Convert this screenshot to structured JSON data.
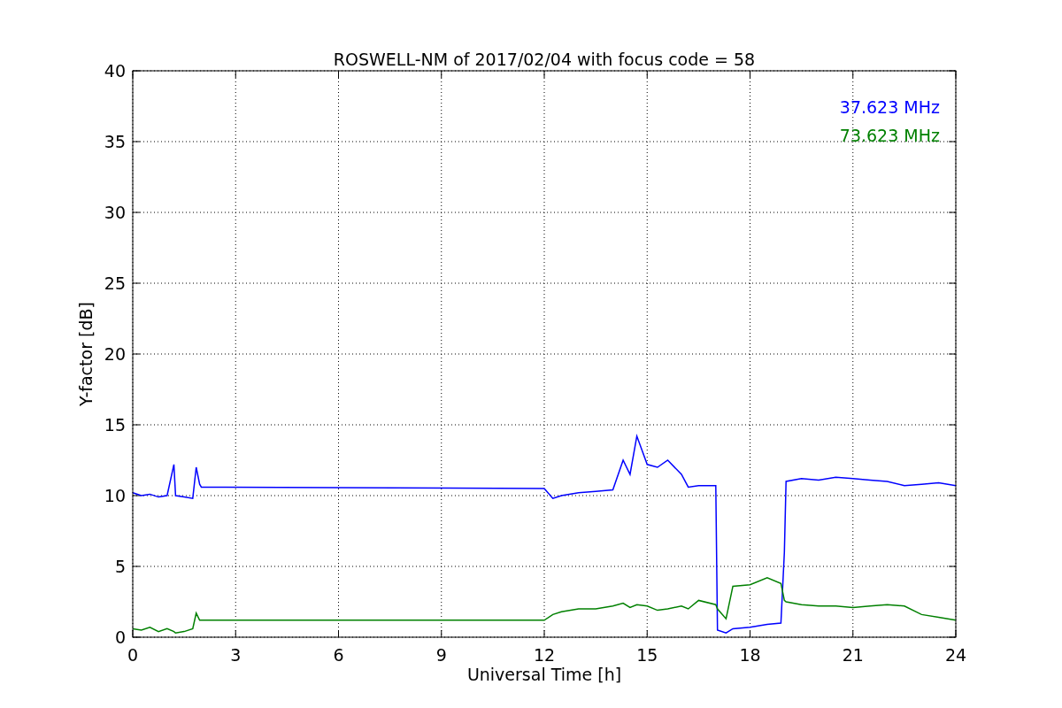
{
  "figure": {
    "chart_data": {
      "type": "line",
      "title": "ROSWELL-NM of 2017/02/04 with focus code = 58",
      "xlabel": "Universal Time [h]",
      "ylabel": "Y-factor [dB]",
      "x": [
        0,
        0.25,
        0.5,
        0.75,
        1,
        1.2,
        1.25,
        1.5,
        1.75,
        1.85,
        1.95,
        2,
        12,
        12.25,
        12.5,
        13,
        13.5,
        14,
        14.3,
        14.5,
        14.7,
        15,
        15.3,
        15.6,
        16,
        16.2,
        16.5,
        17,
        17.05,
        17.3,
        17.5,
        18,
        18.5,
        18.9,
        19,
        19.05,
        19.5,
        20,
        20.5,
        21,
        21.5,
        22,
        22.5,
        23,
        23.5,
        24
      ],
      "series": [
        {
          "name": "37.623 MHz",
          "color": "#0000ff",
          "values": [
            10.2,
            10.0,
            10.1,
            9.9,
            10.0,
            12.2,
            10.0,
            9.9,
            9.8,
            12.0,
            10.8,
            10.6,
            10.5,
            9.8,
            10.0,
            10.2,
            10.3,
            10.4,
            12.5,
            11.5,
            14.2,
            12.2,
            12.0,
            12.5,
            11.5,
            10.6,
            10.7,
            10.7,
            0.5,
            0.3,
            0.6,
            0.7,
            0.9,
            1.0,
            6.0,
            11.0,
            11.2,
            11.1,
            11.3,
            11.2,
            11.1,
            11.0,
            10.7,
            10.8,
            10.9,
            10.7
          ]
        },
        {
          "name": "73.623 MHz",
          "color": "#008000",
          "values": [
            0.6,
            0.5,
            0.7,
            0.4,
            0.6,
            0.4,
            0.3,
            0.4,
            0.6,
            1.7,
            1.2,
            1.2,
            1.2,
            1.6,
            1.8,
            2.0,
            2.0,
            2.2,
            2.4,
            2.1,
            2.3,
            2.2,
            1.9,
            2.0,
            2.2,
            2.0,
            2.6,
            2.3,
            2.0,
            1.3,
            3.6,
            3.7,
            4.2,
            3.8,
            2.6,
            2.5,
            2.3,
            2.2,
            2.2,
            2.1,
            2.2,
            2.3,
            2.2,
            1.6,
            1.4,
            1.2
          ]
        }
      ],
      "xlim": [
        0,
        24
      ],
      "ylim": [
        0,
        40
      ],
      "xticks": [
        0,
        3,
        6,
        9,
        12,
        15,
        18,
        21,
        24
      ],
      "yticks": [
        0,
        5,
        10,
        15,
        20,
        25,
        30,
        35,
        40
      ],
      "grid": true
    }
  }
}
